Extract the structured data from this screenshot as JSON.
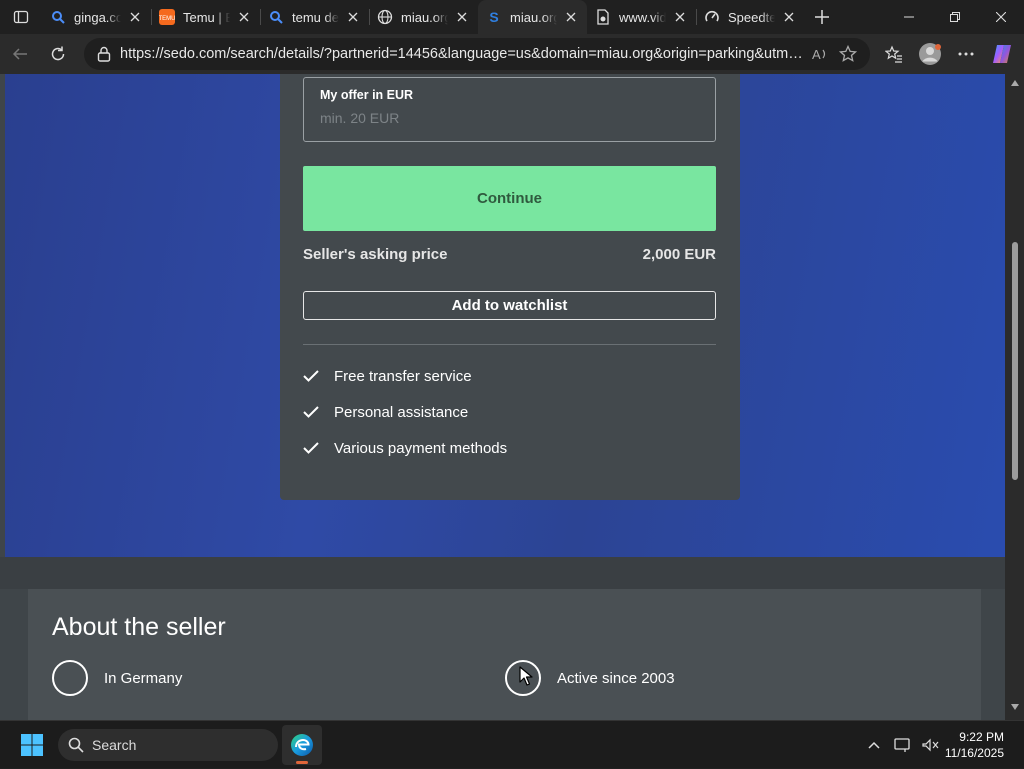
{
  "browser": {
    "tabs": [
      {
        "title": "ginga.co",
        "icon": "search-icon",
        "active": false
      },
      {
        "title": "Temu | Ex",
        "icon": "temu-icon",
        "active": false
      },
      {
        "title": "temu det",
        "icon": "search-icon",
        "active": false
      },
      {
        "title": "miau.org",
        "icon": "globe-icon",
        "active": false
      },
      {
        "title": "miau.org",
        "icon": "sedo-icon",
        "active": true
      },
      {
        "title": "www.vidi",
        "icon": "page-icon",
        "active": false
      },
      {
        "title": "Speedte",
        "icon": "speedtest-icon",
        "active": false
      }
    ],
    "url": "https://sedo.com/search/details/?partnerid=14456&language=us&domain=miau.org&origin=parking&utm_..."
  },
  "offer": {
    "label": "My offer in EUR",
    "placeholder": "min. 20 EUR",
    "continue_label": "Continue",
    "asking_label": "Seller's asking price",
    "asking_value": "2,000 EUR",
    "watchlist_label": "Add to watchlist",
    "features": [
      "Free transfer service",
      "Personal assistance",
      "Various payment methods"
    ]
  },
  "about": {
    "title": "About the seller",
    "location": "In Germany",
    "active_since": "Active since 2003"
  },
  "taskbar": {
    "search_label": "Search",
    "time": "9:22 PM",
    "date": "11/16/2025"
  },
  "colors": {
    "hero_blue": "#2f4aa6",
    "continue_green": "#79e6a0",
    "panel": "#43494d"
  }
}
